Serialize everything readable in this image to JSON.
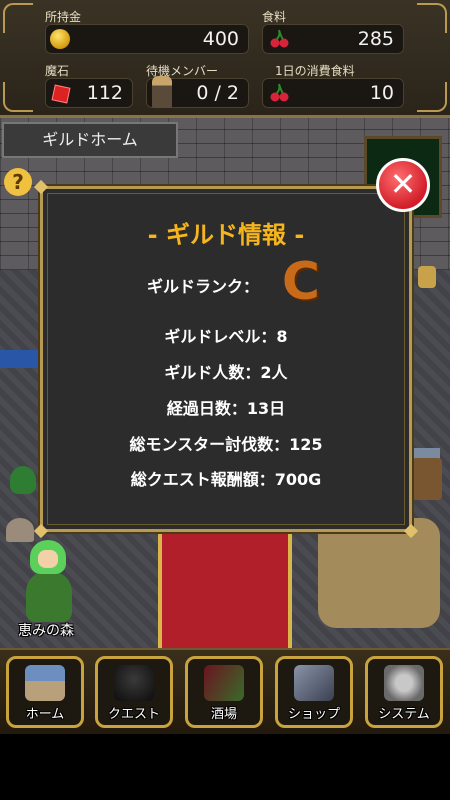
{
  "hud": {
    "money": {
      "label": "所持金",
      "value": "400",
      "icon": "gold-coin-icon"
    },
    "food": {
      "label": "食料",
      "value": "285",
      "icon": "cherry-icon"
    },
    "magic_stone": {
      "label": "魔石",
      "value": "112",
      "icon": "red-gem-icon"
    },
    "standby": {
      "label": "待機メンバー",
      "value": "0 / 2",
      "icon": "hero-portrait-icon"
    },
    "daily_food": {
      "label": "1日の消費食料",
      "value": "10",
      "icon": "cherry-icon"
    }
  },
  "scene": {
    "location_tab": "ギルドホーム",
    "help_glyph": "?",
    "place_name": "恵みの森"
  },
  "modal": {
    "title": "- ギルド情報 -",
    "rank_label": "ギルドランク：",
    "rank_value": "C",
    "lines": [
      "ギルドレベル：8",
      "ギルド人数：2人",
      "経過日数：13日",
      "総モンスター討伐数：125",
      "総クエスト報酬額：700G"
    ],
    "close_glyph": "✕",
    "colors": {
      "title": "#f7b51d",
      "rank": "#c76a1a",
      "close": "#d21e2a"
    }
  },
  "nav": [
    {
      "label": "ホーム",
      "icon": "house-icon"
    },
    {
      "label": "クエスト",
      "icon": "black-knight-icon"
    },
    {
      "label": "酒場",
      "icon": "wine-bottle-icon"
    },
    {
      "label": "ショップ",
      "icon": "shield-sword-icon"
    },
    {
      "label": "システム",
      "icon": "gears-icon"
    }
  ]
}
